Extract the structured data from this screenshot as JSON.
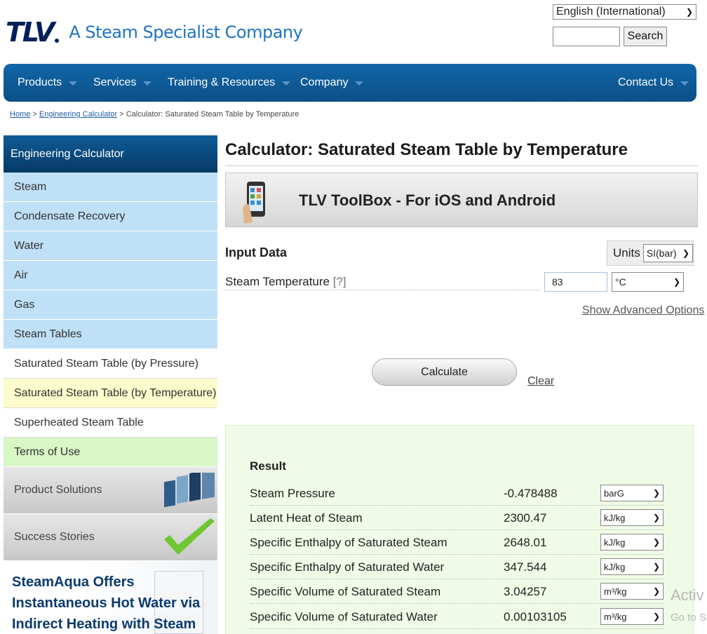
{
  "header": {
    "logo": "TLV",
    "tagline": "A Steam Specialist Company",
    "language": "English (International)",
    "search_label": "Search"
  },
  "nav": {
    "products": "Products",
    "services": "Services",
    "training": "Training & Resources",
    "company": "Company",
    "contact": "Contact Us"
  },
  "breadcrumb": {
    "home": "Home",
    "sep1": " > ",
    "calc": "Engineering Calculator",
    "sep2": " > ",
    "current": "Calculator: Saturated Steam Table by Temperature"
  },
  "sidebar": {
    "header": "Engineering Calculator",
    "items": [
      "Steam",
      "Condensate Recovery",
      "Water",
      "Air",
      "Gas",
      "Steam Tables",
      "Saturated Steam Table (by Pressure)",
      "Saturated Steam Table (by Temperature)",
      "Superheated Steam Table",
      "Terms of Use"
    ],
    "product_solutions": "Product Solutions",
    "success_stories": "Success Stories",
    "promo": "SteamAqua Offers Instantaneous Hot Water via Indirect Heating with Steam"
  },
  "main": {
    "title": "Calculator: Saturated Steam Table by Temperature",
    "toolbox": "TLV ToolBox - For iOS and Android",
    "input_data": "Input Data",
    "units_label": "Units",
    "units_value": "SI(bar)",
    "temp_label": "Steam Temperature",
    "help": "[?]",
    "temp_value": "83",
    "temp_unit": "°C",
    "advanced": "Show Advanced Options",
    "calculate": "Calculate",
    "clear": "Clear"
  },
  "result": {
    "title": "Result",
    "rows": [
      {
        "label": "Steam Pressure",
        "value": "-0.478488",
        "unit": "barG"
      },
      {
        "label": "Latent Heat of Steam",
        "value": "2300.47",
        "unit": "kJ/kg"
      },
      {
        "label": "Specific Enthalpy of Saturated Steam",
        "value": "2648.01",
        "unit": "kJ/kg"
      },
      {
        "label": "Specific Enthalpy of Saturated Water",
        "value": "347.544",
        "unit": "kJ/kg"
      },
      {
        "label": "Specific Volume of Saturated Steam",
        "value": "3.04257",
        "unit": "m³/kg"
      },
      {
        "label": "Specific Volume of Saturated Water",
        "value": "0.00103105",
        "unit": "m³/kg"
      }
    ]
  },
  "watermark": {
    "line1": "Activ",
    "line2": "Go to S"
  }
}
